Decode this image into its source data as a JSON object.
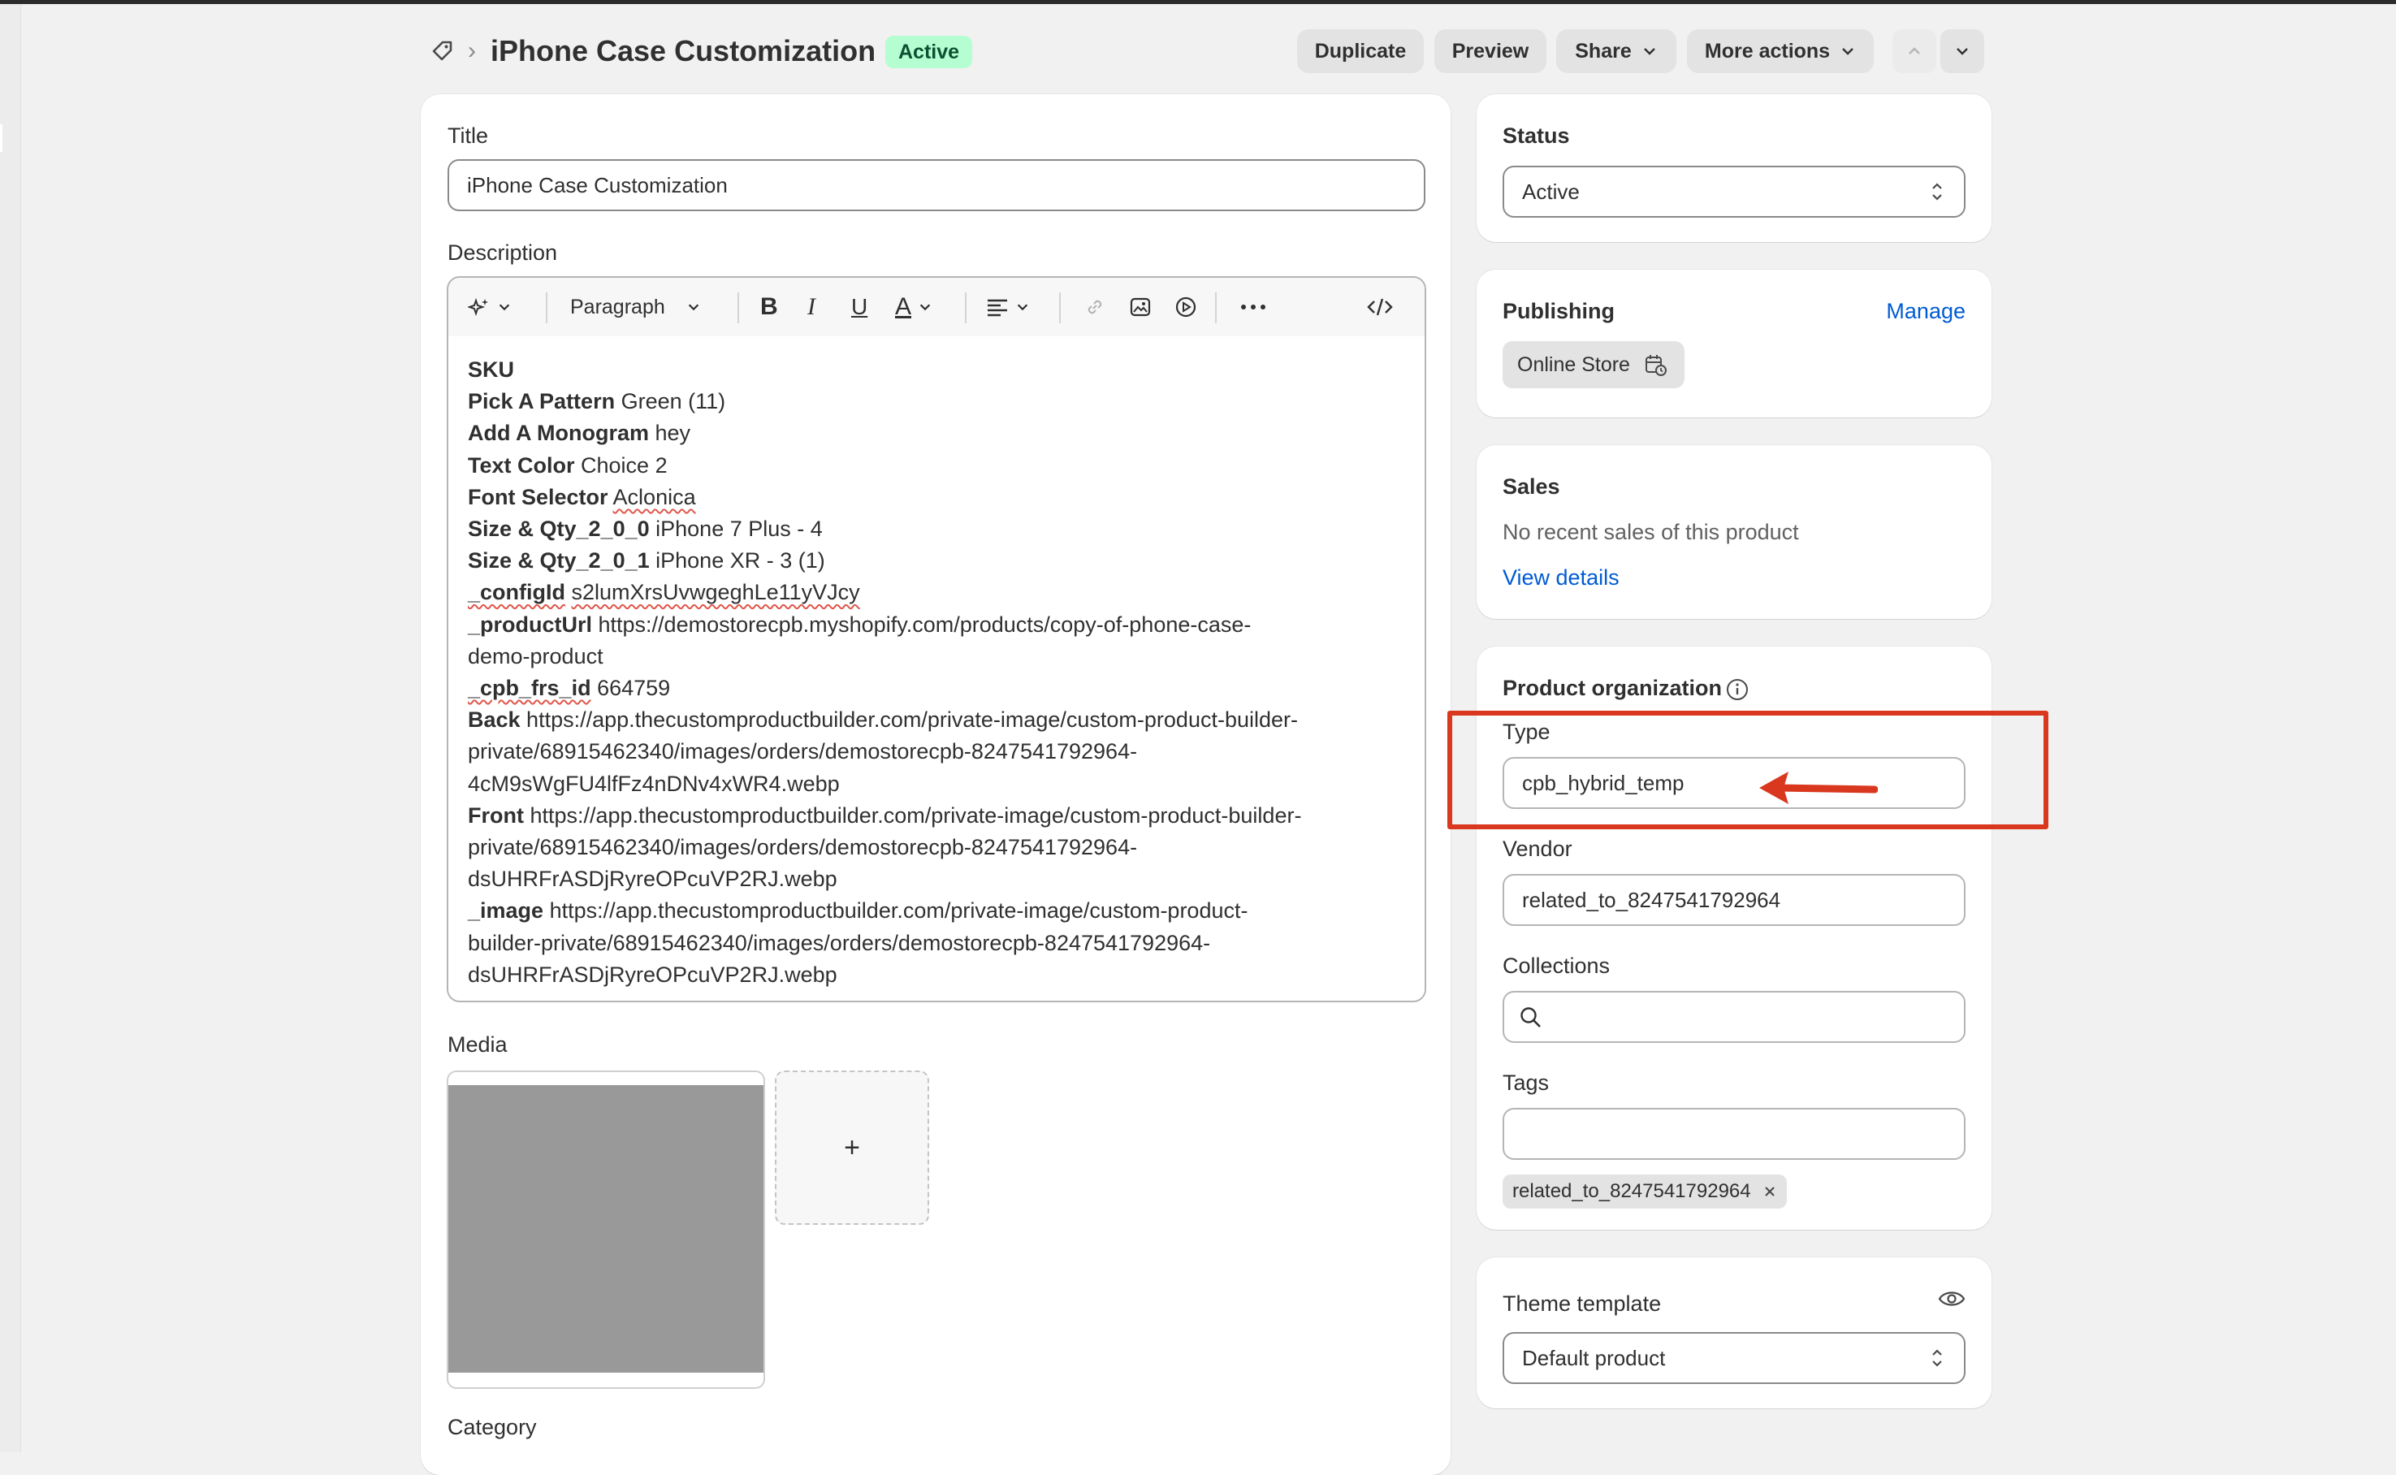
{
  "header": {
    "title": "iPhone Case Customization",
    "status_badge": "Active",
    "buttons": {
      "duplicate": "Duplicate",
      "preview": "Preview",
      "share": "Share",
      "more_actions": "More actions"
    }
  },
  "main": {
    "title_label": "Title",
    "title_value": "iPhone Case Customization",
    "description_label": "Description",
    "toolbar": {
      "paragraph": "Paragraph"
    },
    "description": {
      "sku": "SKU",
      "l1_key": "Pick A Pattern",
      "l1_val": " Green (11)",
      "l2_key": "Add A Monogram",
      "l2_val": " hey",
      "l3_key": "Text Color",
      "l3_val": " Choice 2",
      "l4_key": "Font Selector",
      "l4_val": "Aclonica",
      "l5_key": "Size & Qty_2_0_0",
      "l5_val": " iPhone 7 Plus - 4",
      "l6_key": "Size & Qty_2_0_1",
      "l6_val": " iPhone XR - 3 (1)",
      "l7_key": "_configId",
      "l7_val": "s2lumXrsUvwgeghLe11yVJcy",
      "l8_key": "_productUrl",
      "l8_val_1": " https://demostorecpb.myshopify.com/products/copy-of-phone-case-",
      "l8_val_2": "demo-product",
      "l9_key": "_cpb_frs_id",
      "l9_val": " 664759",
      "l10_key": "Back",
      "l10_val_1": " https://app.thecustomproductbuilder.com/private-image/custom-product-builder-",
      "l10_val_2": "private/68915462340/images/orders/demostorecpb-8247541792964-",
      "l10_val_3": "4cM9sWgFU4lfFz4nDNv4xWR4.webp",
      "l11_key": "Front",
      "l11_val_1": " https://app.thecustomproductbuilder.com/private-image/custom-product-builder-",
      "l11_val_2": "private/68915462340/images/orders/demostorecpb-8247541792964-",
      "l11_val_3": "dsUHRFrASDjRyreOPcuVP2RJ.webp",
      "l12_key": "_image",
      "l12_val_1": " https://app.thecustomproductbuilder.com/private-image/custom-product-",
      "l12_val_2": "builder-private/68915462340/images/orders/demostorecpb-8247541792964-",
      "l12_val_3": "dsUHRFrASDjRyreOPcuVP2RJ.webp"
    },
    "media_label": "Media",
    "media_add": "+",
    "category_label": "Category"
  },
  "sidebar": {
    "status": {
      "label": "Status",
      "value": "Active"
    },
    "publishing": {
      "label": "Publishing",
      "manage": "Manage",
      "channel": "Online Store"
    },
    "sales": {
      "label": "Sales",
      "text": "No recent sales of this product",
      "link": "View details"
    },
    "organization": {
      "label": "Product organization",
      "type_label": "Type",
      "type_value": "cpb_hybrid_temp",
      "vendor_label": "Vendor",
      "vendor_value": "related_to_8247541792964",
      "collections_label": "Collections",
      "tags_label": "Tags",
      "tag_chip": "related_to_8247541792964"
    },
    "theme": {
      "label": "Theme template",
      "value": "Default product"
    }
  },
  "colors": {
    "accent_link": "#005bd3",
    "badge_bg": "#b4fed2",
    "badge_text": "#0c5132",
    "annotation": "#d9381e"
  }
}
